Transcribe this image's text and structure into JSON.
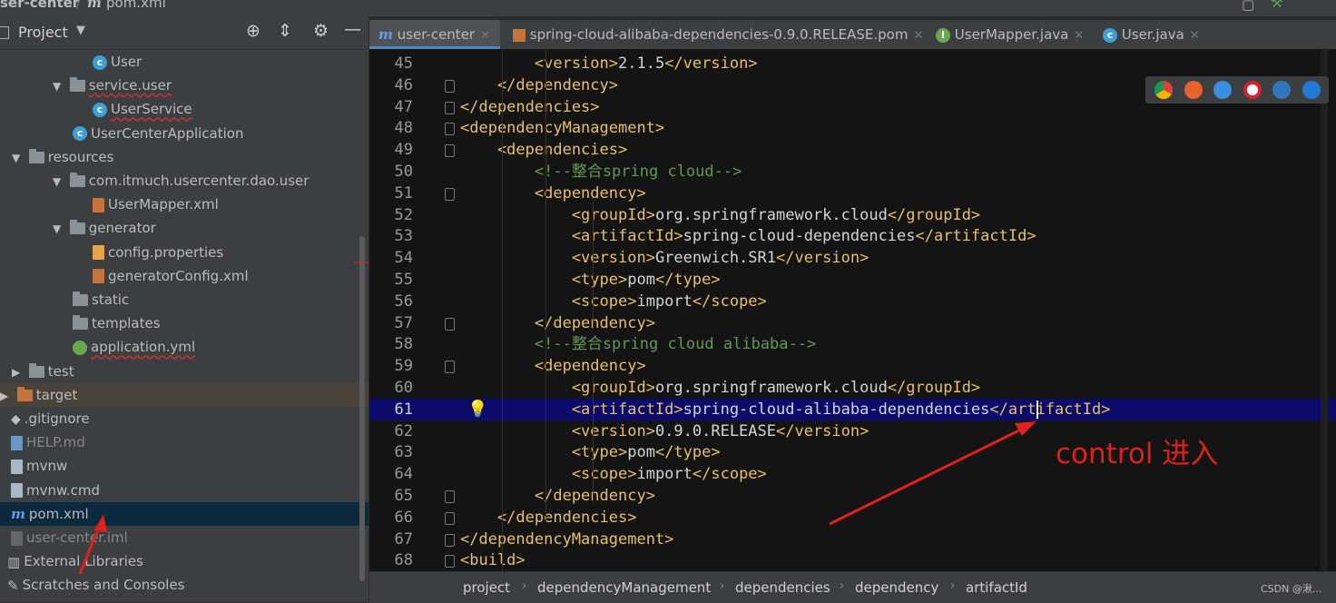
{
  "breadcrumb": {
    "project": "ser-center",
    "file": "pom.xml"
  },
  "project_panel": {
    "title": "Project",
    "tree": [
      {
        "label": "User",
        "icon": "class-c-icon",
        "indent": 3
      },
      {
        "label": "service.user",
        "icon": "package-icon",
        "indent": 2,
        "arrow": "▼"
      },
      {
        "label": "UserService",
        "icon": "class-c-icon",
        "indent": 3
      },
      {
        "label": "UserCenterApplication",
        "icon": "spring-app-icon",
        "indent": 2
      },
      {
        "label": "resources",
        "icon": "resources-folder-icon",
        "indent": 1,
        "arrow": "▼"
      },
      {
        "label": "com.itmuch.usercenter.dao.user",
        "icon": "folder-icon",
        "indent": 2,
        "arrow": "▼"
      },
      {
        "label": "UserMapper.xml",
        "icon": "xml-file-icon",
        "indent": 3
      },
      {
        "label": "generator",
        "icon": "folder-icon",
        "indent": 2,
        "arrow": "▼"
      },
      {
        "label": "config.properties",
        "icon": "properties-file-icon",
        "indent": 3
      },
      {
        "label": "generatorConfig.xml",
        "icon": "xml-file-icon",
        "indent": 3
      },
      {
        "label": "static",
        "icon": "folder-icon",
        "indent": 2
      },
      {
        "label": "templates",
        "icon": "folder-icon",
        "indent": 2
      },
      {
        "label": "application.yml",
        "icon": "yml-file-icon",
        "indent": 2
      },
      {
        "label": "test",
        "icon": "folder-icon",
        "indent": 1,
        "arrow": "▶"
      },
      {
        "label": "target",
        "icon": "orange-folder-icon",
        "indent": 0,
        "arrow": "▶"
      },
      {
        "label": ".gitignore",
        "icon": "git-file-icon",
        "indent": 0
      },
      {
        "label": "HELP.md",
        "icon": "md-file-icon",
        "indent": 0
      },
      {
        "label": "mvnw",
        "icon": "file-icon",
        "indent": 0
      },
      {
        "label": "mvnw.cmd",
        "icon": "file-icon",
        "indent": 0
      },
      {
        "label": "pom.xml",
        "icon": "maven-icon",
        "indent": 0,
        "selected": true
      },
      {
        "label": "user-center.iml",
        "icon": "iml-file-icon",
        "indent": 0
      },
      {
        "label": "External Libraries",
        "icon": "libraries-icon",
        "indent": -1
      },
      {
        "label": "Scratches and Consoles",
        "icon": "scratches-icon",
        "indent": -1
      }
    ]
  },
  "tabs": [
    {
      "label": "user-center",
      "icon": "maven-icon",
      "active": true
    },
    {
      "label": "spring-cloud-alibaba-dependencies-0.9.0.RELEASE.pom",
      "icon": "pom-file-icon"
    },
    {
      "label": "UserMapper.java",
      "icon": "interface-i-icon"
    },
    {
      "label": "User.java",
      "icon": "class-c-icon"
    }
  ],
  "editor": {
    "lines": [
      {
        "n": "45",
        "parts": [
          [
            "tag",
            "        <version>"
          ],
          [
            "txt",
            "2.1.5"
          ],
          [
            "tag",
            "</version>"
          ]
        ]
      },
      {
        "n": "46",
        "parts": [
          [
            "tag",
            "    </dependency>"
          ]
        ]
      },
      {
        "n": "47",
        "parts": [
          [
            "tag",
            "</dependencies>"
          ]
        ]
      },
      {
        "n": "48",
        "parts": [
          [
            "tag",
            "<dependencyManagement>"
          ]
        ]
      },
      {
        "n": "49",
        "parts": [
          [
            "tag",
            "    <dependencies>"
          ]
        ]
      },
      {
        "n": "50",
        "parts": [
          [
            "cmt",
            "        <!--整合spring cloud-->"
          ]
        ]
      },
      {
        "n": "51",
        "parts": [
          [
            "tag",
            "        <dependency>"
          ]
        ]
      },
      {
        "n": "52",
        "parts": [
          [
            "tag",
            "            <groupId>"
          ],
          [
            "txt",
            "org.springframework.cloud"
          ],
          [
            "tag",
            "</groupId>"
          ]
        ]
      },
      {
        "n": "53",
        "parts": [
          [
            "tag",
            "            <artifactId>"
          ],
          [
            "txt",
            "spring-cloud-dependencies"
          ],
          [
            "tag",
            "</artifactId>"
          ]
        ]
      },
      {
        "n": "54",
        "parts": [
          [
            "tag",
            "            <version>"
          ],
          [
            "txt",
            "Greenwich.SR1"
          ],
          [
            "tag",
            "</version>"
          ]
        ]
      },
      {
        "n": "55",
        "parts": [
          [
            "tag",
            "            <type>"
          ],
          [
            "txt",
            "pom"
          ],
          [
            "tag",
            "</type>"
          ]
        ]
      },
      {
        "n": "56",
        "parts": [
          [
            "tag",
            "            <scope>"
          ],
          [
            "txt",
            "import"
          ],
          [
            "tag",
            "</scope>"
          ]
        ]
      },
      {
        "n": "57",
        "parts": [
          [
            "tag",
            "        </dependency>"
          ]
        ]
      },
      {
        "n": "58",
        "parts": [
          [
            "cmt",
            "        <!--整合spring cloud alibaba-->"
          ]
        ]
      },
      {
        "n": "59",
        "parts": [
          [
            "tag",
            "        <dependency>"
          ]
        ]
      },
      {
        "n": "60",
        "parts": [
          [
            "tag",
            "            <groupId>"
          ],
          [
            "txt",
            "org.springframework.cloud"
          ],
          [
            "tag",
            "</groupId>"
          ]
        ]
      },
      {
        "n": "61",
        "parts": [
          [
            "tag",
            "            <artifactId>"
          ],
          [
            "txt",
            "spring-cloud-alibaba-dependencies"
          ],
          [
            "tag",
            "</artifactId>"
          ]
        ],
        "highlight": true
      },
      {
        "n": "62",
        "parts": [
          [
            "tag",
            "            <version>"
          ],
          [
            "txt",
            "0.9.0.RELEASE"
          ],
          [
            "tag",
            "</version>"
          ]
        ]
      },
      {
        "n": "63",
        "parts": [
          [
            "tag",
            "            <type>"
          ],
          [
            "txt",
            "pom"
          ],
          [
            "tag",
            "</type>"
          ]
        ]
      },
      {
        "n": "64",
        "parts": [
          [
            "tag",
            "            <scope>"
          ],
          [
            "txt",
            "import"
          ],
          [
            "tag",
            "</scope>"
          ]
        ]
      },
      {
        "n": "65",
        "parts": [
          [
            "tag",
            "        </dependency>"
          ]
        ]
      },
      {
        "n": "66",
        "parts": [
          [
            "tag",
            "    </dependencies>"
          ]
        ]
      },
      {
        "n": "67",
        "parts": [
          [
            "tag",
            "</dependencyManagement>"
          ]
        ]
      },
      {
        "n": "68",
        "parts": [
          [
            "tag",
            "<build>"
          ]
        ]
      }
    ]
  },
  "status_breadcrumb": [
    "project",
    "dependencyManagement",
    "dependencies",
    "dependency",
    "artifactId"
  ],
  "annotation": "control 进入",
  "watermark": "CSDN @湫...",
  "colors": {
    "highlight_line": "#0b0b6b",
    "annotation": "#e0201a",
    "tag": "#e8bf6a"
  }
}
